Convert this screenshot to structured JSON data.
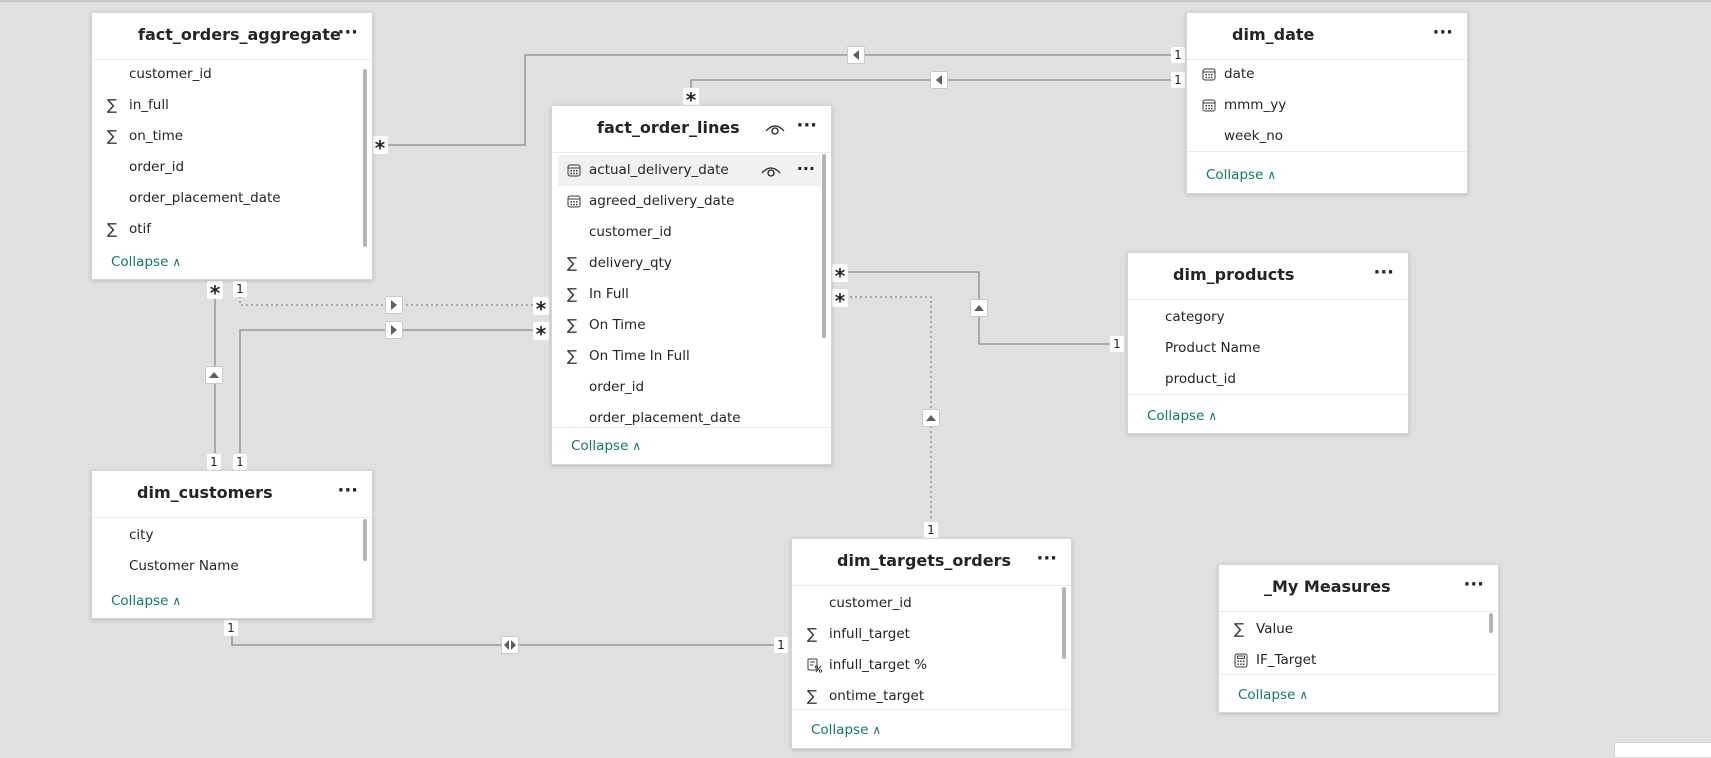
{
  "canvas": {
    "background": "#e1e0de",
    "accent": "#117865"
  },
  "tables": {
    "fact_orders_aggregate": {
      "title": "fact_orders_aggregate",
      "fields": [
        {
          "name": "customer_id",
          "icon": ""
        },
        {
          "name": "in_full",
          "icon": "sigma-icon"
        },
        {
          "name": "on_time",
          "icon": "sigma-icon"
        },
        {
          "name": "order_id",
          "icon": ""
        },
        {
          "name": "order_placement_date",
          "icon": ""
        },
        {
          "name": "otif",
          "icon": "sigma-icon"
        }
      ],
      "collapse": "Collapse"
    },
    "fact_order_lines": {
      "title": "fact_order_lines",
      "fields": [
        {
          "name": "actual_delivery_date",
          "icon": "calendar-icon"
        },
        {
          "name": "agreed_delivery_date",
          "icon": "calendar-icon"
        },
        {
          "name": "customer_id",
          "icon": ""
        },
        {
          "name": "delivery_qty",
          "icon": "sigma-icon"
        },
        {
          "name": "In Full",
          "icon": "sigma-icon"
        },
        {
          "name": "On Time",
          "icon": "sigma-icon"
        },
        {
          "name": "On Time In Full",
          "icon": "sigma-icon"
        },
        {
          "name": "order_id",
          "icon": ""
        },
        {
          "name": "order_placement_date",
          "icon": ""
        }
      ],
      "collapse": "Collapse"
    },
    "dim_date": {
      "title": "dim_date",
      "fields": [
        {
          "name": "date",
          "icon": "calendar-icon"
        },
        {
          "name": "mmm_yy",
          "icon": "calendar-icon"
        },
        {
          "name": "week_no",
          "icon": ""
        }
      ],
      "collapse": "Collapse"
    },
    "dim_products": {
      "title": "dim_products",
      "fields": [
        {
          "name": "category",
          "icon": ""
        },
        {
          "name": "Product Name",
          "icon": ""
        },
        {
          "name": "product_id",
          "icon": ""
        }
      ],
      "collapse": "Collapse"
    },
    "dim_customers": {
      "title": "dim_customers",
      "fields": [
        {
          "name": "city",
          "icon": ""
        },
        {
          "name": "Customer Name",
          "icon": ""
        }
      ],
      "collapse": "Collapse"
    },
    "dim_targets_orders": {
      "title": "dim_targets_orders",
      "fields": [
        {
          "name": "customer_id",
          "icon": ""
        },
        {
          "name": "infull_target",
          "icon": "sigma-icon"
        },
        {
          "name": "infull_target %",
          "icon": "measure-percent-icon"
        },
        {
          "name": "ontime_target",
          "icon": "sigma-icon"
        }
      ],
      "collapse": "Collapse"
    },
    "my_measures": {
      "title": "_My Measures",
      "fields": [
        {
          "name": "Value",
          "icon": "sigma-icon"
        },
        {
          "name": "IF_Target",
          "icon": "calculator-icon"
        }
      ],
      "collapse": "Collapse"
    }
  },
  "cardinality": {
    "one": "1",
    "many": "*"
  },
  "more_label": "···",
  "sigma": "∑",
  "chevron_up": "∧"
}
